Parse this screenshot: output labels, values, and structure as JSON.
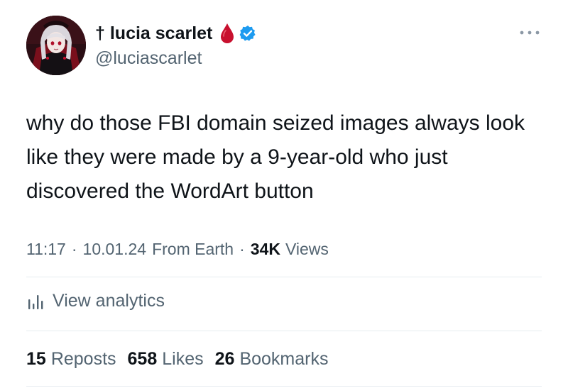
{
  "author": {
    "display_name": "† lucia scarlet",
    "handle": "@luciascarlet",
    "verified_color": "#1d9bf0",
    "drop_color": "#c8102e",
    "avatar_icon": "avatar-anime-portrait"
  },
  "tweet": {
    "text": "why do those FBI domain seized images always look like they were made by a 9-year-old who just discovered the WordArt button"
  },
  "meta": {
    "time": "11:17",
    "date": "10.01.24",
    "source": "From Earth",
    "separator": "·",
    "views_count": "34K",
    "views_label": "Views"
  },
  "analytics": {
    "label": "View analytics"
  },
  "stats": {
    "reposts_count": "15",
    "reposts_label": "Reposts",
    "likes_count": "658",
    "likes_label": "Likes",
    "bookmarks_count": "26",
    "bookmarks_label": "Bookmarks"
  },
  "colors": {
    "text_primary": "#0f1419",
    "text_secondary": "#536471",
    "divider": "#e6ecf0"
  }
}
